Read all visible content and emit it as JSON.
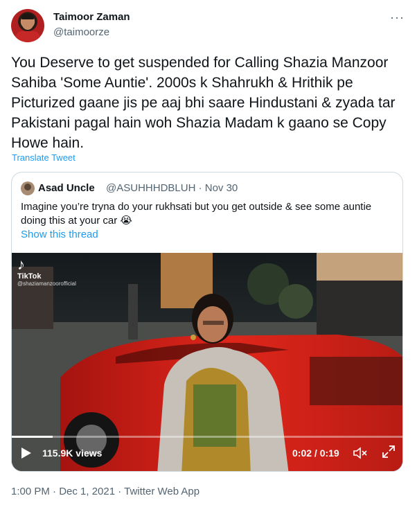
{
  "tweet": {
    "author_name": "Taimoor Zaman",
    "author_handle": "@taimoorze",
    "more_label": "···",
    "text": "You Deserve to get suspended for Calling Shazia Manzoor Sahiba 'Some Auntie'. 2000s k Shahrukh & Hrithik pe Picturized gaane jis pe aaj bhi saare Hindustani & zyada tar Pakistani pagal hain woh Shazia Madam k gaano se Copy Howe hain.",
    "translate_label": "Translate Tweet",
    "footer_meta": "1:00 PM · Dec 1, 2021 · Twitter Web App"
  },
  "quote": {
    "author_name": "Asad Uncle",
    "author_handle_date": "@ASUHHHDBLUH · Nov 30",
    "text": "Imagine you’re tryna do your rukhsati but you get outside & see some auntie doing this at your car 😭",
    "show_thread_label": "Show this thread"
  },
  "video": {
    "watermark_logo": "♪",
    "watermark_brand": "TikTok",
    "watermark_user": "@shaziamanzoorofficial",
    "views": "115.9K views",
    "time": "0:02 / 0:19",
    "progress": 0.105,
    "mute_icon": "mute-icon",
    "expand_icon": "expand-icon"
  },
  "colors": {
    "link": "#1d9bf0",
    "secondary_text": "#536471",
    "border": "#cfd9de"
  }
}
